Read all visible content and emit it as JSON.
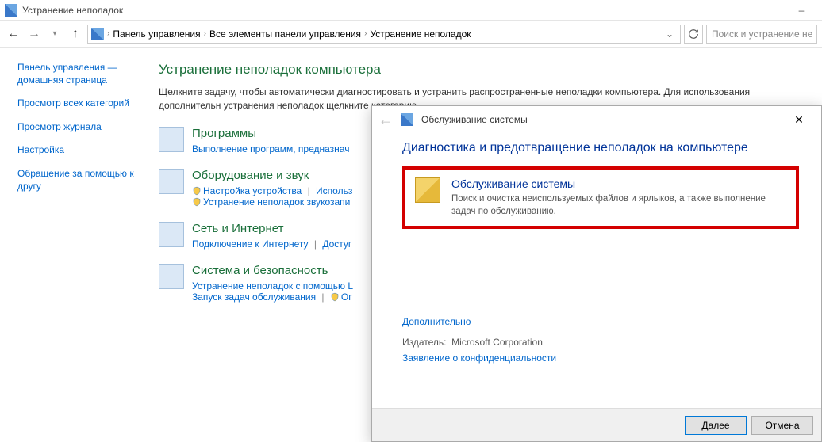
{
  "titlebar": {
    "title": "Устранение неполадок"
  },
  "navbar": {
    "crumbs": [
      "Панель управления",
      "Все элементы панели управления",
      "Устранение неполадок"
    ],
    "search_placeholder": "Поиск и устранение не"
  },
  "sidebar": {
    "items": [
      "Панель управления — домашняя страница",
      "Просмотр всех категорий",
      "Просмотр журнала",
      "Настройка",
      "Обращение за помощью к другу"
    ]
  },
  "content": {
    "heading": "Устранение неполадок компьютера",
    "desc": "Щелкните задачу, чтобы автоматически диагностировать и устранить распространенные неполадки компьютера. Для использования дополнительн устранения неполадок щелкните категорию",
    "categories": [
      {
        "title": "Программы",
        "links": [
          {
            "label": "Выполнение программ, предназнач",
            "shield": false
          }
        ]
      },
      {
        "title": "Оборудование и звук",
        "links": [
          {
            "label": "Настройка устройства",
            "shield": true
          },
          {
            "label": "Использ",
            "shield": false
          }
        ],
        "links2": [
          {
            "label": "Устранение неполадок звукозапи",
            "shield": true
          }
        ]
      },
      {
        "title": "Сеть и Интернет",
        "links": [
          {
            "label": "Подключение к Интернету",
            "shield": false
          },
          {
            "label": "Достуг",
            "shield": false
          }
        ]
      },
      {
        "title": "Система и безопасность",
        "links": [
          {
            "label": "Устранение неполадок с помощью L",
            "shield": false
          }
        ],
        "links2": [
          {
            "label": "Запуск задач обслуживания",
            "shield": false
          },
          {
            "label": "Ог",
            "shield": true
          }
        ]
      }
    ]
  },
  "dialog": {
    "window_title": "Обслуживание системы",
    "heading": "Диагностика и предотвращение неполадок на компьютере",
    "item_title": "Обслуживание системы",
    "item_desc": "Поиск и очистка неиспользуемых файлов и ярлыков, а также выполнение задач по обслуживанию.",
    "advanced": "Дополнительно",
    "publisher_label": "Издатель:",
    "publisher": "Microsoft Corporation",
    "privacy": "Заявление о конфиденциальности",
    "btn_next": "Далее",
    "btn_cancel": "Отмена"
  }
}
